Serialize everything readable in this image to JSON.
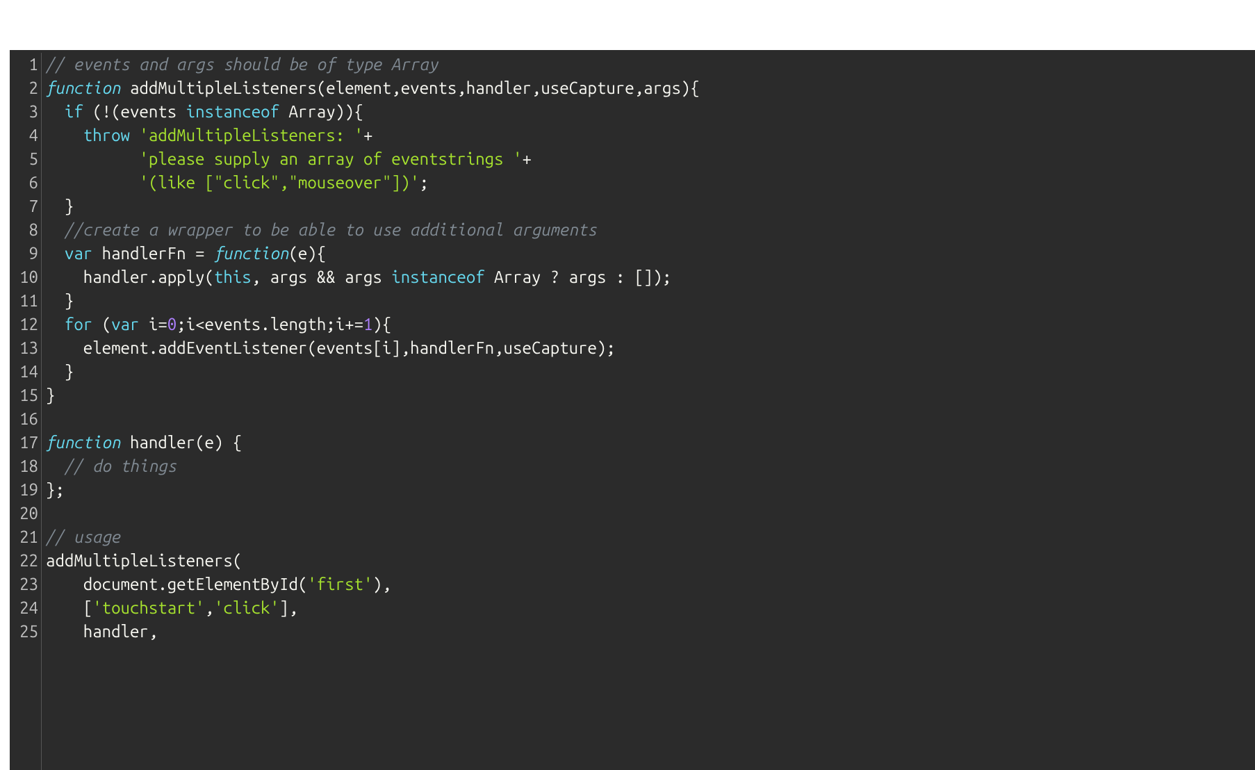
{
  "editor": {
    "lineNumbers": [
      "1",
      "2",
      "3",
      "4",
      "5",
      "6",
      "7",
      "8",
      "9",
      "10",
      "11",
      "12",
      "13",
      "14",
      "15",
      "16",
      "17",
      "18",
      "19",
      "20",
      "21",
      "22",
      "23",
      "24",
      "25"
    ],
    "lines": [
      [
        {
          "cls": "c-comment",
          "t": "// events and args should be of type Array"
        }
      ],
      [
        {
          "cls": "c-keyword-it",
          "t": "function"
        },
        {
          "cls": "c-ident",
          "t": " addMultipleListeners(element,events,handler,useCapture,args){"
        }
      ],
      [
        {
          "cls": "c-ident",
          "t": "  "
        },
        {
          "cls": "c-keyword",
          "t": "if"
        },
        {
          "cls": "c-ident",
          "t": " (!(events "
        },
        {
          "cls": "c-keyword",
          "t": "instanceof"
        },
        {
          "cls": "c-ident",
          "t": " Array)){"
        }
      ],
      [
        {
          "cls": "c-ident",
          "t": "    "
        },
        {
          "cls": "c-keyword",
          "t": "throw"
        },
        {
          "cls": "c-ident",
          "t": " "
        },
        {
          "cls": "c-string",
          "t": "'addMultipleListeners: '"
        },
        {
          "cls": "c-ident",
          "t": "+"
        }
      ],
      [
        {
          "cls": "c-ident",
          "t": "          "
        },
        {
          "cls": "c-string",
          "t": "'please supply an array of eventstrings '"
        },
        {
          "cls": "c-ident",
          "t": "+"
        }
      ],
      [
        {
          "cls": "c-ident",
          "t": "          "
        },
        {
          "cls": "c-string",
          "t": "'(like [\"click\",\"mouseover\"])'"
        },
        {
          "cls": "c-ident",
          "t": ";"
        }
      ],
      [
        {
          "cls": "c-ident",
          "t": "  }"
        }
      ],
      [
        {
          "cls": "c-ident",
          "t": "  "
        },
        {
          "cls": "c-comment",
          "t": "//create a wrapper to be able to use additional arguments"
        }
      ],
      [
        {
          "cls": "c-ident",
          "t": "  "
        },
        {
          "cls": "c-keyword",
          "t": "var"
        },
        {
          "cls": "c-ident",
          "t": " handlerFn = "
        },
        {
          "cls": "c-keyword-it",
          "t": "function"
        },
        {
          "cls": "c-ident",
          "t": "(e){"
        }
      ],
      [
        {
          "cls": "c-ident",
          "t": "    handler.apply("
        },
        {
          "cls": "c-keyword",
          "t": "this"
        },
        {
          "cls": "c-ident",
          "t": ", args && args "
        },
        {
          "cls": "c-keyword",
          "t": "instanceof"
        },
        {
          "cls": "c-ident",
          "t": " Array ? args : []);"
        }
      ],
      [
        {
          "cls": "c-ident",
          "t": "  }"
        }
      ],
      [
        {
          "cls": "c-ident",
          "t": "  "
        },
        {
          "cls": "c-keyword",
          "t": "for"
        },
        {
          "cls": "c-ident",
          "t": " ("
        },
        {
          "cls": "c-keyword",
          "t": "var"
        },
        {
          "cls": "c-ident",
          "t": " i="
        },
        {
          "cls": "c-number",
          "t": "0"
        },
        {
          "cls": "c-ident",
          "t": ";i<events.length;i+="
        },
        {
          "cls": "c-number",
          "t": "1"
        },
        {
          "cls": "c-ident",
          "t": "){"
        }
      ],
      [
        {
          "cls": "c-ident",
          "t": "    element.addEventListener(events[i],handlerFn,useCapture);"
        }
      ],
      [
        {
          "cls": "c-ident",
          "t": "  }"
        }
      ],
      [
        {
          "cls": "c-ident",
          "t": "}"
        }
      ],
      [
        {
          "cls": "c-ident",
          "t": ""
        }
      ],
      [
        {
          "cls": "c-keyword-it",
          "t": "function"
        },
        {
          "cls": "c-ident",
          "t": " handler(e) {"
        }
      ],
      [
        {
          "cls": "c-ident",
          "t": "  "
        },
        {
          "cls": "c-comment",
          "t": "// do things"
        }
      ],
      [
        {
          "cls": "c-ident",
          "t": "};"
        }
      ],
      [
        {
          "cls": "c-ident",
          "t": ""
        }
      ],
      [
        {
          "cls": "c-comment",
          "t": "// usage"
        }
      ],
      [
        {
          "cls": "c-ident",
          "t": "addMultipleListeners("
        }
      ],
      [
        {
          "cls": "c-ident",
          "t": "    document.getElementById("
        },
        {
          "cls": "c-string",
          "t": "'first'"
        },
        {
          "cls": "c-ident",
          "t": "),"
        }
      ],
      [
        {
          "cls": "c-ident",
          "t": "    ["
        },
        {
          "cls": "c-string",
          "t": "'touchstart'"
        },
        {
          "cls": "c-ident",
          "t": ","
        },
        {
          "cls": "c-string",
          "t": "'click'"
        },
        {
          "cls": "c-ident",
          "t": "],"
        }
      ],
      [
        {
          "cls": "c-ident",
          "t": "    handler,"
        }
      ]
    ]
  }
}
